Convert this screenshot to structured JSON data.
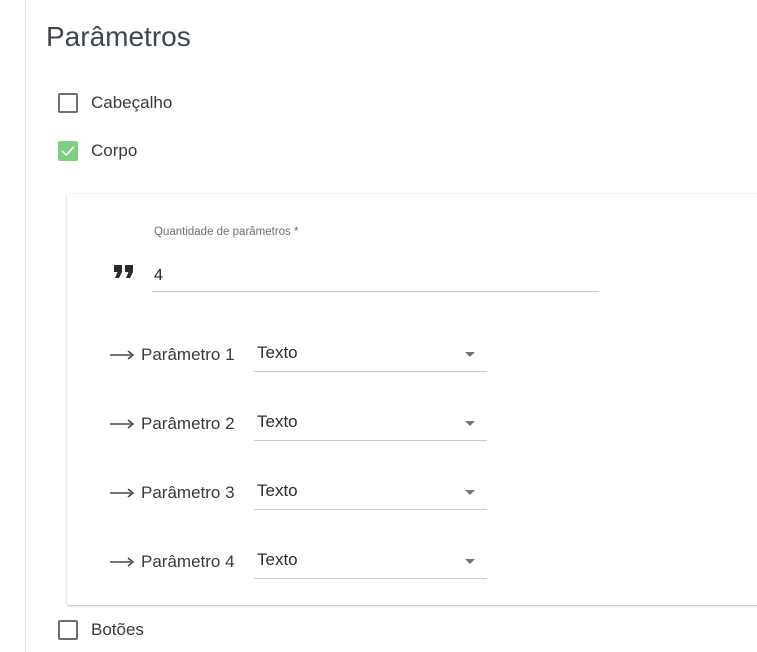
{
  "section": {
    "title": "Parâmetros"
  },
  "options": [
    {
      "label": "Cabeçalho",
      "checked": false
    },
    {
      "label": "Corpo",
      "checked": true
    },
    {
      "label": "Botões",
      "checked": false
    }
  ],
  "body": {
    "quantity_label": "Quantidade de parâmetros *",
    "quantity_value": "4",
    "params": [
      {
        "label": "Parâmetro 1",
        "type": "Texto"
      },
      {
        "label": "Parâmetro 2",
        "type": "Texto"
      },
      {
        "label": "Parâmetro 3",
        "type": "Texto"
      },
      {
        "label": "Parâmetro 4",
        "type": "Texto"
      }
    ]
  },
  "colors": {
    "checkbox_checked": "#7ed07f",
    "title": "#404650",
    "underline": "#c9c9c9"
  },
  "icons": {
    "quantity": "format-quote-icon",
    "param": "arrow-right-icon",
    "select": "caret-down-icon",
    "checked": "check-icon"
  }
}
